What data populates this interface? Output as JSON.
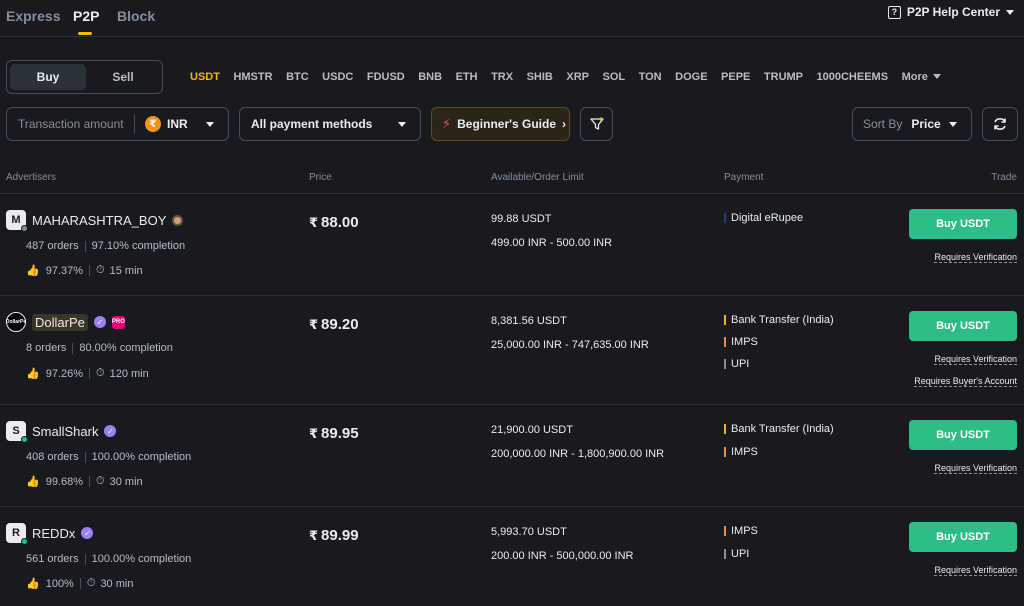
{
  "tabs": [
    {
      "label": "Express",
      "active": false
    },
    {
      "label": "P2P",
      "active": true
    },
    {
      "label": "Block",
      "active": false
    }
  ],
  "help_center": "P2P Help Center",
  "trade_toggle": {
    "buy": "Buy",
    "sell": "Sell",
    "selected": "Buy"
  },
  "coins": [
    "USDT",
    "HMSTR",
    "BTC",
    "USDC",
    "FDUSD",
    "BNB",
    "ETH",
    "TRX",
    "SHIB",
    "XRP",
    "SOL",
    "TON",
    "DOGE",
    "PEPE",
    "TRUMP",
    "1000CHEEMS"
  ],
  "active_coin": "USDT",
  "more_label": "More",
  "filters": {
    "amount_placeholder": "Transaction amount",
    "fiat": "INR",
    "fiat_symbol": "₹",
    "payment": "All payment methods",
    "guide": "Beginner's Guide",
    "sort_label": "Sort By",
    "sort_value": "Price"
  },
  "columns": {
    "advertisers": "Advertisers",
    "price": "Price",
    "available": "Available/Order Limit",
    "payment": "Payment",
    "trade": "Trade"
  },
  "ads": [
    {
      "avatar": "M",
      "name": "MAHARASHTRA_BOY",
      "orders": "487 orders",
      "completion": "97.10% completion",
      "rating": "97.37%",
      "time": "15 min",
      "price_symbol": "₹",
      "price": "88.00",
      "available": "99.88 USDT",
      "limit": "499.00 INR - 500.00 INR",
      "payments": [
        {
          "name": "Digital eRupee",
          "color": "#1e3a8a"
        }
      ],
      "button": "Buy USDT",
      "notes": [
        "Requires Verification"
      ]
    },
    {
      "avatar": "DollarPe",
      "name": "DollarPe",
      "orders": "8 orders",
      "completion": "80.00% completion",
      "rating": "97.26%",
      "time": "120 min",
      "price_symbol": "₹",
      "price": "89.20",
      "available": "8,381.56 USDT",
      "limit": "25,000.00 INR - 747,635.00 INR",
      "payments": [
        {
          "name": "Bank Transfer (India)",
          "color": "#f0b90b"
        },
        {
          "name": "IMPS",
          "color": "#f08a3b"
        },
        {
          "name": "UPI",
          "color": "#848e9c"
        }
      ],
      "button": "Buy USDT",
      "notes": [
        "Requires Verification",
        "Requires Buyer's Account"
      ]
    },
    {
      "avatar": "S",
      "name": "SmallShark",
      "orders": "408 orders",
      "completion": "100.00% completion",
      "rating": "99.68%",
      "time": "30 min",
      "price_symbol": "₹",
      "price": "89.95",
      "available": "21,900.00 USDT",
      "limit": "200,000.00 INR - 1,800,900.00 INR",
      "payments": [
        {
          "name": "Bank Transfer (India)",
          "color": "#f0b90b"
        },
        {
          "name": "IMPS",
          "color": "#f08a3b"
        }
      ],
      "button": "Buy USDT",
      "notes": [
        "Requires Verification"
      ]
    },
    {
      "avatar": "R",
      "name": "REDDx",
      "orders": "561 orders",
      "completion": "100.00% completion",
      "rating": "100%",
      "time": "30 min",
      "price_symbol": "₹",
      "price": "89.99",
      "available": "5,993.70 USDT",
      "limit": "200.00 INR - 500,000.00 INR",
      "payments": [
        {
          "name": "IMPS",
          "color": "#f08a3b"
        },
        {
          "name": "UPI",
          "color": "#848e9c"
        }
      ],
      "button": "Buy USDT",
      "notes": [
        "Requires Verification"
      ]
    }
  ]
}
